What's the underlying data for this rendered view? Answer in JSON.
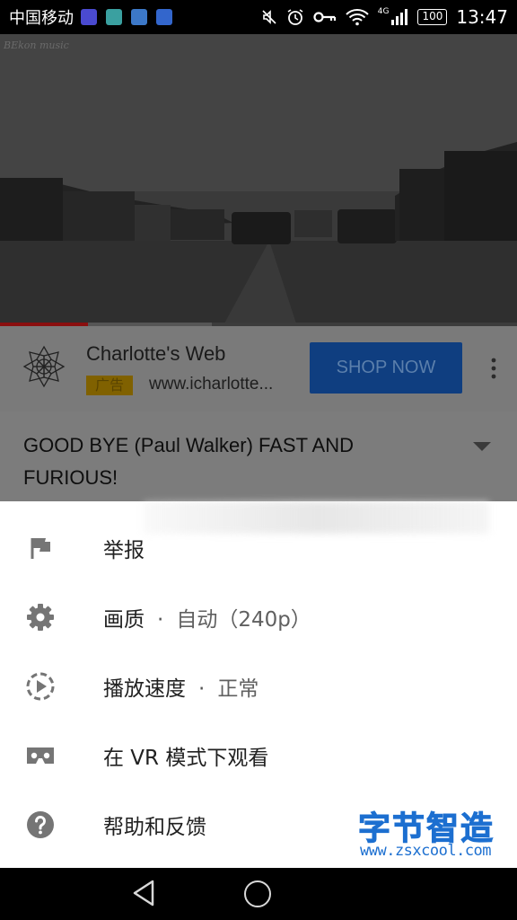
{
  "status_bar": {
    "carrier": "中国移动",
    "network_type": "4G",
    "battery": "100",
    "time": "13:47",
    "notification_icons": [
      "photos-icon",
      "contacts-icon",
      "gallery-icon",
      "b-app-icon"
    ],
    "notification_colors": [
      "#4a4ad0",
      "#3aa0a0",
      "#3c78c8",
      "#3366cc"
    ]
  },
  "video": {
    "channel_watermark": "BEkon music",
    "progress_fraction": 0.17,
    "buffer_fraction": 0.41
  },
  "ad": {
    "advertiser": "Charlotte's Web",
    "badge": "广告",
    "url": "www.icharlotte...",
    "cta_label": "SHOP NOW"
  },
  "video_title": "GOOD BYE (Paul Walker) FAST AND FURIOUS!",
  "menu": {
    "items": [
      {
        "icon": "flag-icon",
        "label": "举报"
      },
      {
        "icon": "gear-icon",
        "label": "画质",
        "value": "自动（240p）"
      },
      {
        "icon": "playback-speed-icon",
        "label": "播放速度",
        "value": "正常"
      },
      {
        "icon": "vr-headset-icon",
        "label": "在 VR 模式下观看"
      },
      {
        "icon": "help-icon",
        "label": "帮助和反馈"
      }
    ]
  },
  "site_watermark": {
    "title": "字节智造",
    "url": "www.zsxcool.com"
  },
  "colors": {
    "accent_blue": "#1c6fd0",
    "icon_grey": "#757575"
  }
}
